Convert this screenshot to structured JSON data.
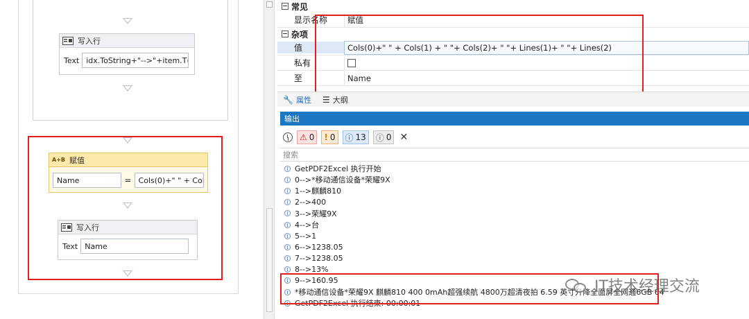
{
  "designer": {
    "write_line_1": {
      "title": "写入行",
      "text_label": "Text",
      "text_value": "idx.ToString+\"-->\"+item.T("
    },
    "assign": {
      "badge": "A+B",
      "title": "赋值",
      "to_value": "Name",
      "equals": "=",
      "value": "Cols(0)+\" \" + Col"
    },
    "write_line_2": {
      "title": "写入行",
      "text_label": "Text",
      "text_value": "Name"
    }
  },
  "properties": {
    "categories": [
      {
        "name": "常见",
        "rows": [
          {
            "name": "显示名称",
            "value": "赋值"
          }
        ]
      },
      {
        "name": "杂项",
        "rows": [
          {
            "name": "值",
            "value": "Cols(0)+\" \" + Cols(1) + \" \"+ Cols(2)+ \" \"+ Lines(1)+ \" \"+ Lines(2)"
          },
          {
            "name": "私有",
            "value": ""
          },
          {
            "name": "至",
            "value": "Name"
          }
        ]
      }
    ],
    "tabs": [
      {
        "label": "属性",
        "icon": "wrench-icon"
      },
      {
        "label": "大纲",
        "icon": "outline-icon"
      }
    ]
  },
  "output": {
    "title": "输出",
    "counts": {
      "errors": "0",
      "warnings": "0",
      "info": "13",
      "trace": "0"
    },
    "search_placeholder": "搜索",
    "lines": [
      "GetPDF2Excel 执行开始",
      "0-->*移动通信设备*荣耀9X",
      "1-->麒麟810",
      "2-->400",
      "3-->荣耀9X",
      "4-->台",
      "5-->1",
      "6-->1238.05",
      "7-->1238.05",
      "8-->13%",
      "9-->160.95",
      "*移动通信设备*荣耀9X 麒麟810 400 0mAh超强续航 4800万超清夜拍 6.59 英寸升降全面屏全网通6GB 64",
      "GetPDF2Excel 执行结束: 00:00:01"
    ]
  },
  "watermark": {
    "text": "IT技术经理交流"
  },
  "colors": {
    "highlight": "#e11d1d",
    "output_bar": "#1c77c3",
    "assign_header": "#fde9a9"
  }
}
